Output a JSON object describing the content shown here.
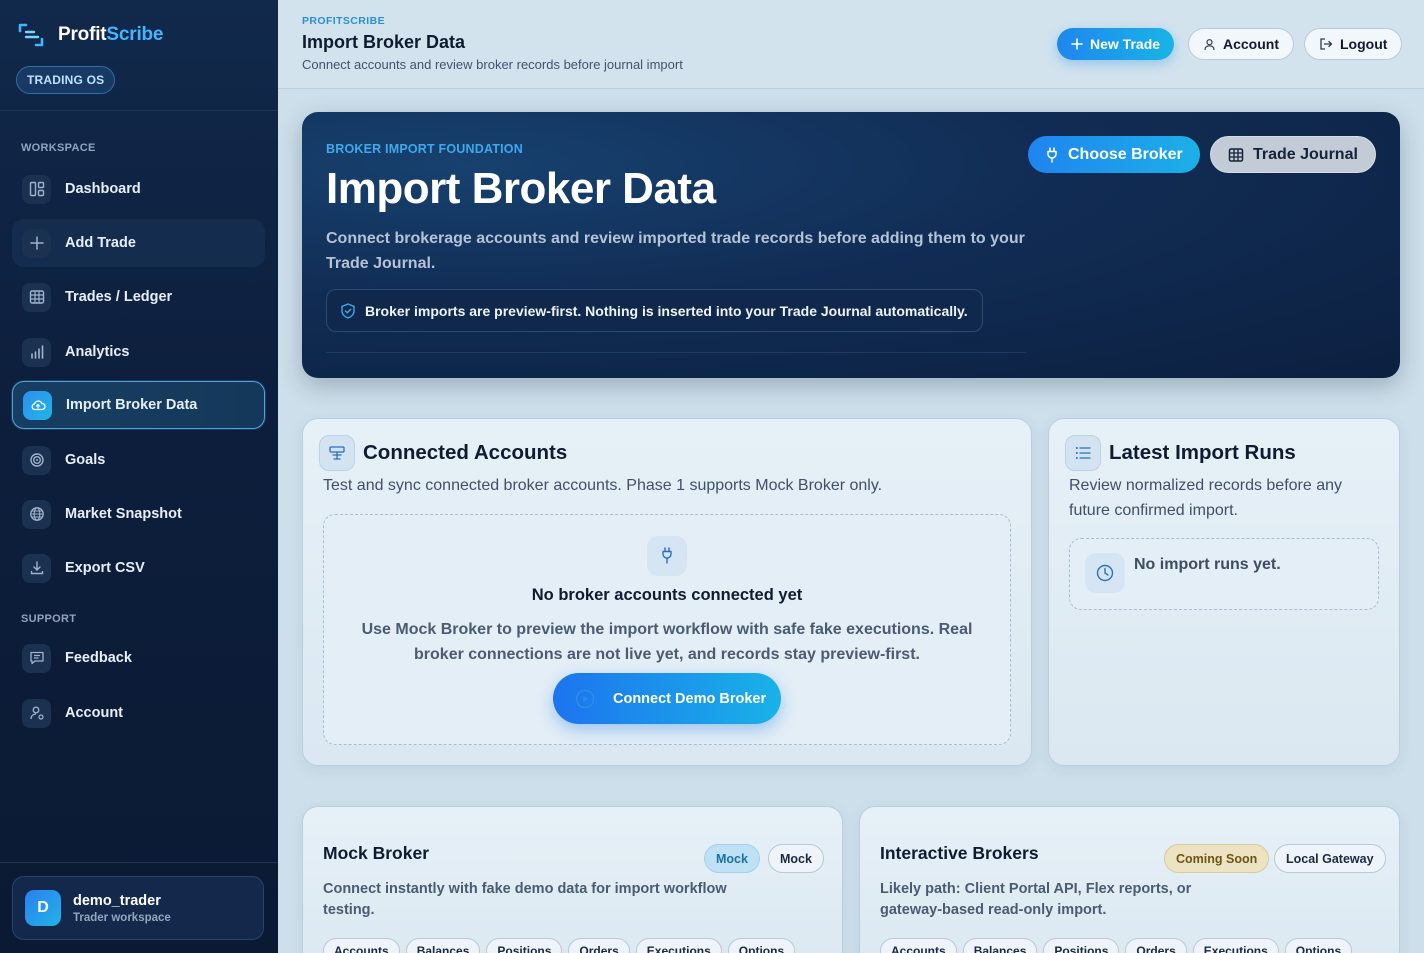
{
  "sidebar": {
    "brand_part1": "Profit",
    "brand_part2": "Scribe",
    "badge": "TRADING OS",
    "section_workspace": "WORKSPACE",
    "section_support": "SUPPORT",
    "items": [
      {
        "label": "Dashboard",
        "icon": "dashboard-icon"
      },
      {
        "label": "Add Trade",
        "icon": "plus-icon"
      },
      {
        "label": "Trades / Ledger",
        "icon": "table-icon"
      },
      {
        "label": "Analytics",
        "icon": "bar-chart-icon"
      },
      {
        "label": "Import Broker Data",
        "icon": "cloud-upload-icon",
        "active": true
      },
      {
        "label": "Goals",
        "icon": "target-icon"
      },
      {
        "label": "Market Snapshot",
        "icon": "globe-icon"
      },
      {
        "label": "Export CSV",
        "icon": "download-icon"
      }
    ],
    "support_items": [
      {
        "label": "Feedback",
        "icon": "message-icon"
      },
      {
        "label": "Account",
        "icon": "user-settings-icon"
      }
    ],
    "user": {
      "initial": "D",
      "name": "demo_trader",
      "role": "Trader workspace"
    }
  },
  "header": {
    "crumb": "PROFITSCRIBE",
    "title": "Import Broker Data",
    "subtitle": "Connect accounts and review broker records before journal import",
    "new_trade": "New Trade",
    "account": "Account",
    "logout": "Logout"
  },
  "hero": {
    "eyebrow": "BROKER IMPORT FOUNDATION",
    "title": "Import Broker Data",
    "description": "Connect brokerage accounts and review imported trade records before adding them to your Trade Journal.",
    "note": "Broker imports are preview-first. Nothing is inserted into your Trade Journal automatically.",
    "choose_broker": "Choose Broker",
    "trade_journal": "Trade Journal"
  },
  "connected": {
    "title": "Connected Accounts",
    "subtitle": "Test and sync connected broker accounts. Phase 1 supports Mock Broker only.",
    "empty_title": "No broker accounts connected yet",
    "empty_text": "Use Mock Broker to preview the import workflow with safe fake executions. Real broker connections are not live yet, and records stay preview-first.",
    "connect_button": "Connect Demo Broker"
  },
  "runs": {
    "title": "Latest Import Runs",
    "subtitle": "Review normalized records before any future confirmed import.",
    "empty": "No import runs yet."
  },
  "brokers": [
    {
      "name": "Mock Broker",
      "status": "Mock",
      "mode": "Mock",
      "description": "Connect instantly with fake demo data for import workflow testing.",
      "tags": [
        "Accounts",
        "Balances",
        "Positions",
        "Orders",
        "Executions",
        "Options"
      ]
    },
    {
      "name": "Interactive Brokers",
      "status": "Coming Soon",
      "mode": "Local Gateway",
      "description": "Likely path: Client Portal API, Flex reports, or gateway-based read-only import.",
      "tags": [
        "Accounts",
        "Balances",
        "Positions",
        "Orders",
        "Executions",
        "Options"
      ]
    }
  ],
  "colors": {
    "accent": "#1f86ef",
    "accent2": "#1ab4e6",
    "sidebar": "#0d1f3d",
    "coming_soon_bg": "#ece3c2"
  }
}
